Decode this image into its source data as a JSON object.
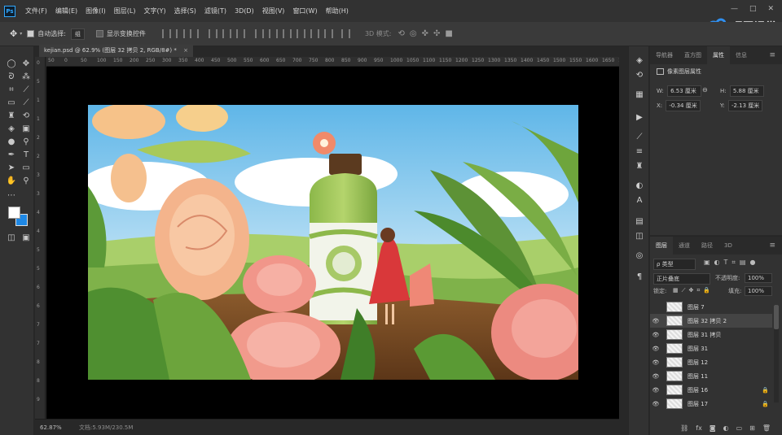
{
  "app": {
    "logo": "Ps"
  },
  "menu": [
    "文件(F)",
    "编辑(E)",
    "图像(I)",
    "图层(L)",
    "文字(Y)",
    "选择(S)",
    "滤镜(T)",
    "3D(D)",
    "视图(V)",
    "窗口(W)",
    "帮助(H)"
  ],
  "window_controls": [
    "—",
    "□",
    "✕"
  ],
  "watermark": {
    "text": "巧匠课堂",
    "sub": "QIAOJIANG.COM"
  },
  "options": {
    "auto_select_label": "自动选择:",
    "auto_select_value": "组",
    "show_transform_label": "显示变换控件",
    "mode_3d_label": "3D 模式:"
  },
  "document": {
    "tab_title": "kejian.psd @ 62.9% (图层 32 拷贝 2, RGB/8#) *",
    "tab_close": "×"
  },
  "rulers": {
    "h": [
      "50",
      "0",
      "50",
      "100",
      "150",
      "200",
      "250",
      "300",
      "350",
      "400",
      "450",
      "500",
      "550",
      "600",
      "650",
      "700",
      "750",
      "800",
      "850",
      "900",
      "950",
      "1000",
      "1050",
      "1100",
      "1150",
      "1200",
      "1250",
      "1300",
      "1350",
      "1400",
      "1450",
      "1500",
      "1550",
      "1600",
      "1650",
      "1700"
    ],
    "v": [
      "0",
      "5",
      "1",
      "1",
      "2",
      "2",
      "3",
      "3",
      "4",
      "4",
      "5",
      "5",
      "6",
      "6",
      "7",
      "7",
      "8",
      "8",
      "9"
    ]
  },
  "status": {
    "zoom": "62.87%",
    "doc": "文档:5.93M/230.5M"
  },
  "properties": {
    "tabs": [
      "导航器",
      "直方图",
      "属性",
      "信息"
    ],
    "active_tab": "属性",
    "header": "像素图层属性",
    "w_label": "W:",
    "w_value": "6.53 厘米",
    "h_label": "H:",
    "h_value": "5.88 厘米",
    "x_label": "X:",
    "x_value": "-0.34 厘米",
    "y_label": "Y:",
    "y_value": "-2.13 厘米"
  },
  "layers_panel": {
    "tabs": [
      "图层",
      "通道",
      "路径",
      "3D"
    ],
    "active_tab": "图层",
    "filter_label": "ρ 类型",
    "blend_mode": "正片叠底",
    "opacity_label": "不透明度:",
    "opacity_value": "100%",
    "lock_label": "锁定:",
    "fill_label": "填充:",
    "fill_value": "100%",
    "layers": [
      {
        "name": "图层 7",
        "visible": false,
        "locked": false,
        "selected": false
      },
      {
        "name": "图层 32 拷贝 2",
        "visible": true,
        "locked": false,
        "selected": true
      },
      {
        "name": "图层 31 拷贝",
        "visible": true,
        "locked": false,
        "selected": false
      },
      {
        "name": "图层 31",
        "visible": true,
        "locked": false,
        "selected": false
      },
      {
        "name": "图层 12",
        "visible": true,
        "locked": false,
        "selected": false
      },
      {
        "name": "图层 11",
        "visible": true,
        "locked": false,
        "selected": false
      },
      {
        "name": "图层 16",
        "visible": true,
        "locked": true,
        "selected": false
      },
      {
        "name": "图层 17",
        "visible": true,
        "locked": true,
        "selected": false
      }
    ],
    "bottom_icons": [
      "link-icon",
      "fx-icon",
      "mask-icon",
      "adjustment-icon",
      "group-icon",
      "new-layer-icon",
      "trash-icon"
    ]
  },
  "colors": {
    "foreground": "#ffffff",
    "background": "#1e88e5",
    "accent": "#31a8ff"
  }
}
